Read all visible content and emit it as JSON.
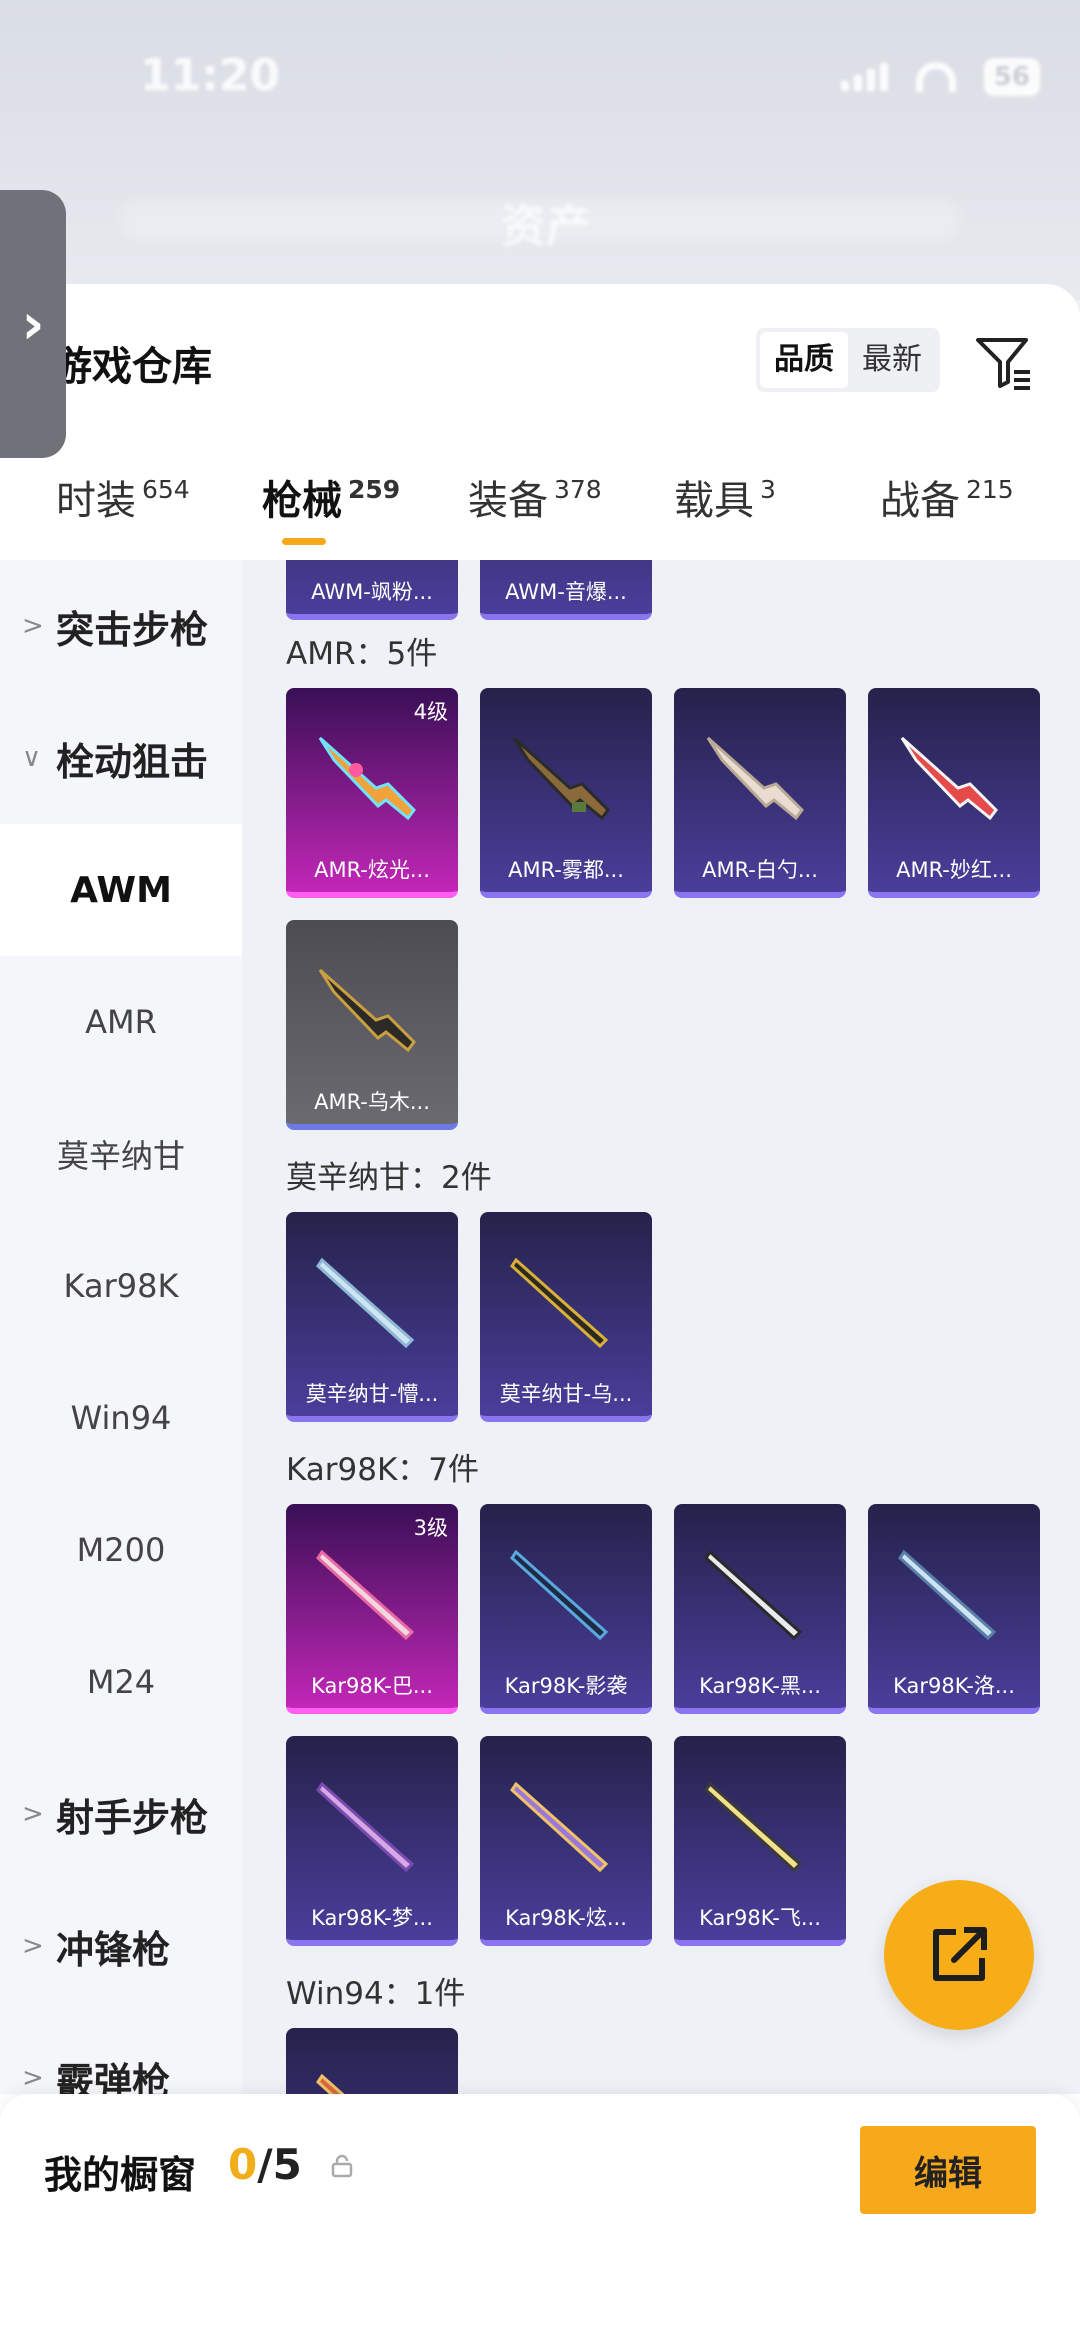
{
  "status": {
    "time": "11:20",
    "battery": "56"
  },
  "header": {
    "blur_title": "资产"
  },
  "panel": {
    "title": "游戏仓库",
    "sort_options": [
      "品质",
      "最新"
    ]
  },
  "tabs": [
    {
      "label": "时装",
      "count": "654"
    },
    {
      "label": "枪械",
      "count": "259"
    },
    {
      "label": "装备",
      "count": "378"
    },
    {
      "label": "载具",
      "count": "3"
    },
    {
      "label": "战备",
      "count": "215"
    }
  ],
  "sidebar": {
    "cat_assault": "突击步枪",
    "cat_bolt": "栓动狙击",
    "sub_awm": "AWM",
    "sub_amr": "AMR",
    "sub_mosin": "莫辛纳甘",
    "sub_kar": "Kar98K",
    "sub_win": "Win94",
    "sub_m200": "M200",
    "sub_m24": "M24",
    "cat_marksman": "射手步枪",
    "cat_smg": "冲锋枪",
    "cat_shotgun": "霰弹枪"
  },
  "sections": {
    "awm_partial": [
      "AWM-飒粉...",
      "AWM-音爆..."
    ],
    "amr": {
      "title": "AMR：5件",
      "items": [
        "AMR-炫光...",
        "AMR-雾都...",
        "AMR-白勺...",
        "AMR-妙红...",
        "AMR-乌木..."
      ],
      "level_badge": "4级"
    },
    "mosin": {
      "title": "莫辛纳甘：2件",
      "items": [
        "莫辛纳甘-懵...",
        "莫辛纳甘-乌..."
      ]
    },
    "kar": {
      "title": "Kar98K：7件",
      "items": [
        "Kar98K-巴...",
        "Kar98K-影袭",
        "Kar98K-黑...",
        "Kar98K-洛...",
        "Kar98K-梦...",
        "Kar98K-炫...",
        "Kar98K-飞..."
      ],
      "level_badge": "3级"
    },
    "win": {
      "title": "Win94：1件"
    }
  },
  "bottom": {
    "label": "我的橱窗",
    "current": "0",
    "total": "/5",
    "edit_label": "编辑"
  },
  "colors": {
    "accent": "#f7a81b",
    "card_epic": "#4a3e9b",
    "card_legend": "#c227b7"
  }
}
